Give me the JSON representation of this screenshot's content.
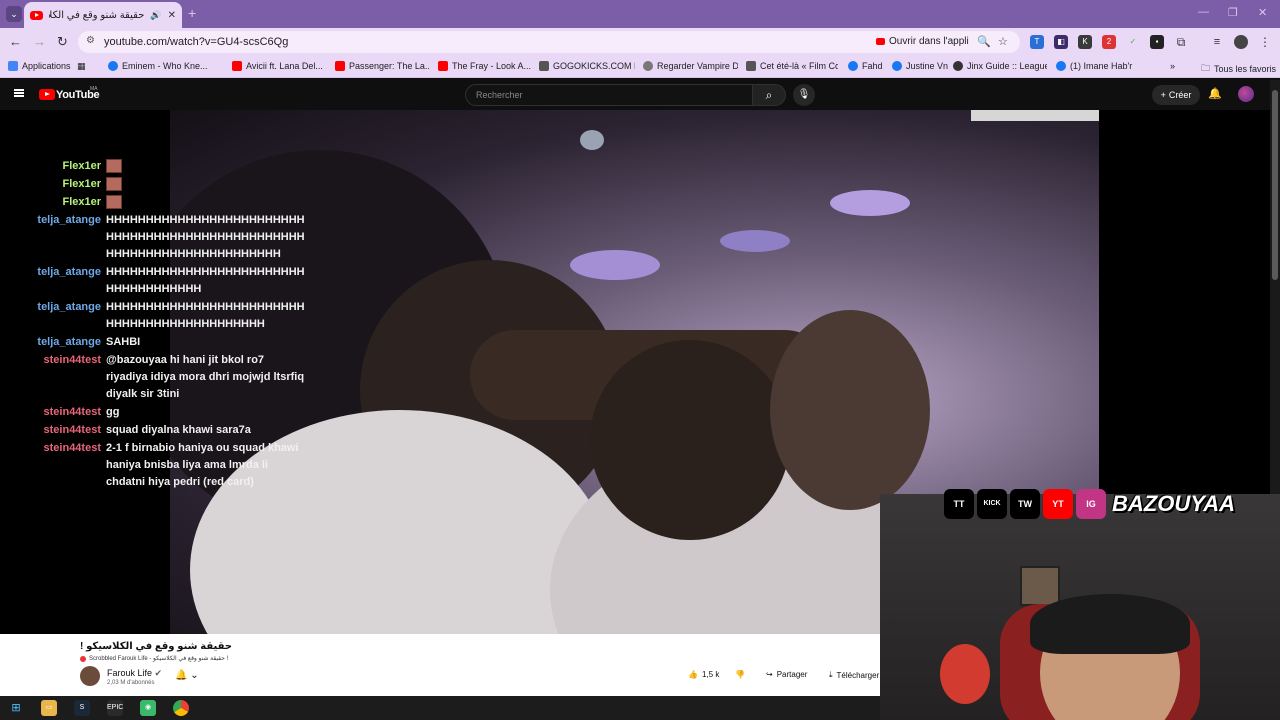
{
  "browser": {
    "tab_title": "حقيقة شنو وقع في الكلاسيكو",
    "tab_audio_icon": "speaker-icon",
    "url": "youtube.com/watch?v=GU4-scsC6Qg",
    "open_in_app": "Ouvrir dans l'appli",
    "bookmarks": [
      {
        "label": "Applications",
        "color": "#4285f4"
      },
      {
        "label": "Eminem - Who Kne...",
        "color": "#1877f2"
      },
      {
        "label": "Avicii ft. Lana Del...",
        "color": "#ff0000"
      },
      {
        "label": "Passenger: The La...",
        "color": "#ff0000"
      },
      {
        "label": "The Fray - Look A...",
        "color": "#ff0000"
      },
      {
        "label": "GOGOKICKS.COM H...",
        "color": "#555555"
      },
      {
        "label": "Regarder Vampire D...",
        "color": "#777777"
      },
      {
        "label": "Cet été-là « Film Co...",
        "color": "#555555"
      },
      {
        "label": "Fahd",
        "color": "#1877f2"
      },
      {
        "label": "Justine Vn",
        "color": "#1877f2"
      },
      {
        "label": "Jinx Guide :: League...",
        "color": "#333333"
      },
      {
        "label": "(1) Imane Hab'r",
        "color": "#1877f2"
      }
    ],
    "all_bookmarks": "Tous les favoris",
    "bookmarks_more": "»"
  },
  "youtube": {
    "logo_text": "YouTube",
    "region": "MA",
    "search_placeholder": "Rechercher",
    "create_label": "Créer"
  },
  "chat": [
    {
      "user": "Flex1er",
      "text": "",
      "color": "#b8f27a",
      "emote": true
    },
    {
      "user": "Flex1er",
      "text": "",
      "color": "#b8f27a",
      "emote": true
    },
    {
      "user": "Flex1er",
      "text": "",
      "color": "#b8f27a",
      "emote": true
    },
    {
      "user": "telja_atange",
      "text": "HHHHHHHHHHHHHHHHHHHHHHHHHHHHHHHHHHHHHHHHHHHHHHHHHHHHHHHHHHHHHHHHHHHHHHHH",
      "color": "#6fa8e8",
      "emote": false
    },
    {
      "user": "telja_atange",
      "text": "HHHHHHHHHHHHHHHHHHHHHHHHHHHHHHHHHHHHH",
      "color": "#6fa8e8",
      "emote": false
    },
    {
      "user": "telja_atange",
      "text": "HHHHHHHHHHHHHHHHHHHHHHHHHHHHHHHHHHHHHHHHHHHHH",
      "color": "#6fa8e8",
      "emote": false
    },
    {
      "user": "telja_atange",
      "text": "SAHBI",
      "color": "#6fa8e8",
      "emote": false
    },
    {
      "user": "stein44test",
      "text": "@bazouyaa hi hani jit bkol ro7 riyadiya idiya mora dhri mojwjd ltsrfiq diyalk sir 3tini",
      "color": "#e8657a",
      "emote": false
    },
    {
      "user": "stein44test",
      "text": "gg",
      "color": "#e8657a",
      "emote": false
    },
    {
      "user": "stein44test",
      "text": "squad diyalna khawi sara7a",
      "color": "#e8657a",
      "emote": false
    },
    {
      "user": "stein44test",
      "text": "2-1 f birnabio haniya ou squad khawi haniya bnisba liya ama lmrda li chdatni hiya pedri (red card)",
      "color": "#e8657a",
      "emote": false
    }
  ],
  "overlay": {
    "socials": [
      "TT",
      "KICK",
      "TW",
      "YT",
      "IG"
    ],
    "handle": "BAZOUYAA"
  },
  "video": {
    "title": "حقيقة شنو وقع في الكلاسيكو !",
    "scrobbled": "Scrobbled Farouk Life - حقيقة شنو وقع في الكلاسيكو !",
    "channel": "Farouk Life",
    "subscribers": "2,03 M d'abonnés",
    "likes": "1,5 k",
    "share": "Partager",
    "download": "Télécharger"
  }
}
